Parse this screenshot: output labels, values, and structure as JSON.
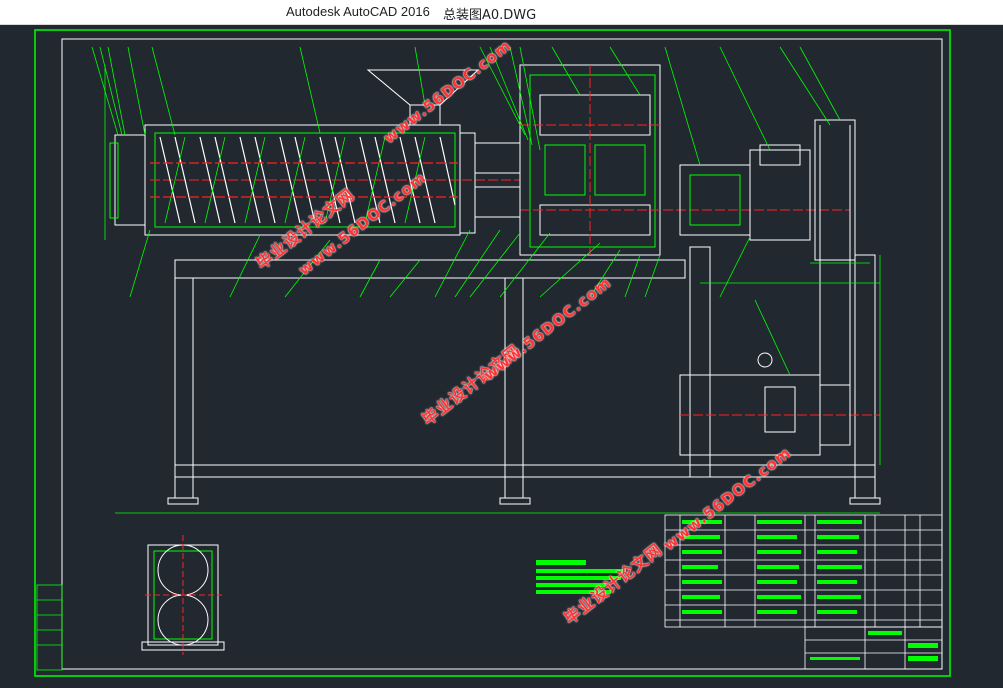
{
  "window": {
    "app_title": "Autodesk AutoCAD 2016",
    "document_title": "总装图A0.DWG"
  },
  "watermarks": [
    {
      "text": "毕业设计论文网",
      "url": "www.56DOC.com"
    },
    {
      "text": "毕业设计论文网",
      "url": "www.56DOC.com"
    },
    {
      "text": "毕业设计论文网",
      "url": "www.56DOC.com"
    },
    {
      "text": "毕业设计论文网",
      "url": "www.56DOC.com"
    }
  ],
  "colors": {
    "background": "#212830",
    "frame": "#00ff00",
    "geometry": "#ffffff",
    "centerline": "#ff2020",
    "watermark": "#ff3333"
  }
}
